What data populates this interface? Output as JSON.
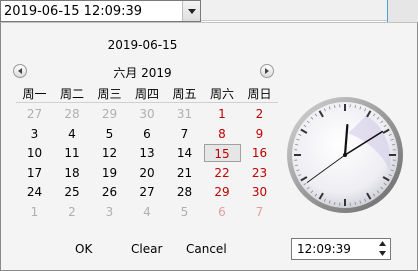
{
  "combo": {
    "value": "2019-06-15 12:09:39"
  },
  "calendar": {
    "date_title": "2019-06-15",
    "month_title": "六月 2019",
    "weekdays": [
      "周一",
      "周二",
      "周三",
      "周四",
      "周五",
      "周六",
      "周日"
    ],
    "weeks": [
      [
        "27",
        "28",
        "29",
        "30",
        "31",
        "1",
        "2"
      ],
      [
        "3",
        "4",
        "5",
        "6",
        "7",
        "8",
        "9"
      ],
      [
        "10",
        "11",
        "12",
        "13",
        "14",
        "15",
        "16"
      ],
      [
        "17",
        "18",
        "19",
        "20",
        "21",
        "22",
        "23"
      ],
      [
        "24",
        "25",
        "26",
        "27",
        "28",
        "29",
        "30"
      ],
      [
        "1",
        "2",
        "3",
        "4",
        "5",
        "6",
        "7"
      ]
    ],
    "selected_day": "15"
  },
  "clock": {
    "hour": 12,
    "minute": 9,
    "second": 39
  },
  "buttons": {
    "ok": "OK",
    "clear": "Clear",
    "cancel": "Cancel"
  },
  "time": {
    "value": "12:09:39"
  },
  "colors": {
    "weekend": "#c00000",
    "other_month": "#b0b0b0",
    "accent": "#4f9fd8"
  },
  "icons": {
    "dropdown": "triangle-down-icon",
    "prev": "arrow-left-icon",
    "next": "arrow-right-icon",
    "spin_up": "triangle-up-icon",
    "spin_down": "triangle-down-icon"
  }
}
